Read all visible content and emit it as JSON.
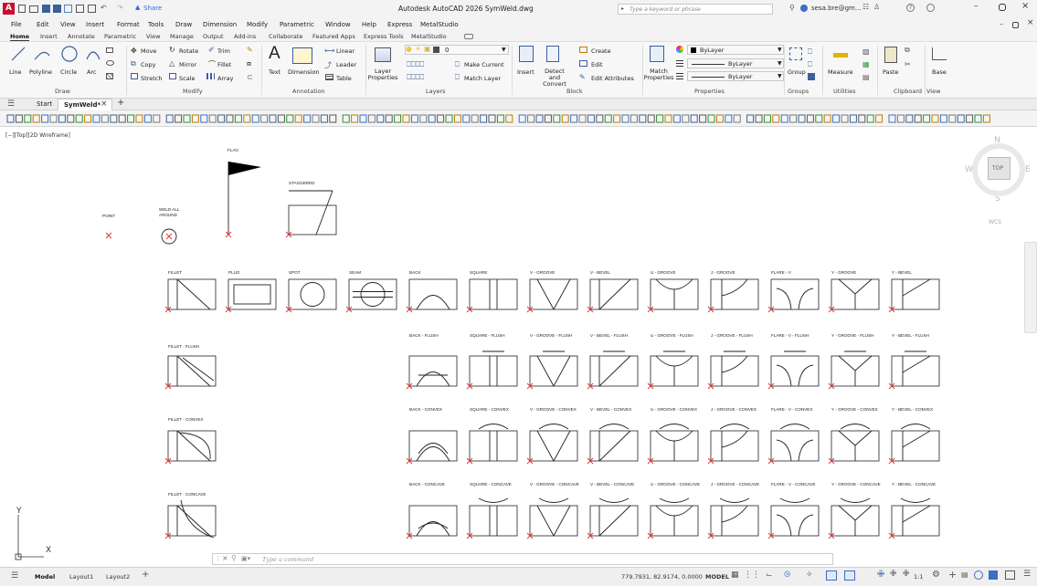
{
  "app": {
    "title": "Autodesk AutoCAD 2026  SymWeld.dwg",
    "logo_letter": "A",
    "share_label": "Share",
    "search_placeholder": "Type a keyword or phrase",
    "user": "sesa.bre@gm...",
    "brand_color": "#c8102e"
  },
  "menu": [
    "File",
    "Edit",
    "View",
    "Insert",
    "Format",
    "Tools",
    "Draw",
    "Dimension",
    "Modify",
    "Parametric",
    "Window",
    "Help",
    "Express",
    "MetalStudio"
  ],
  "ribbon_tabs": [
    "Home",
    "Insert",
    "Annotate",
    "Parametric",
    "View",
    "Manage",
    "Output",
    "Add-ins",
    "Collaborate",
    "Featured Apps",
    "Express Tools",
    "MetalStudio"
  ],
  "ribbon": {
    "draw": {
      "line": "Line",
      "polyline": "Polyline",
      "circle": "Circle",
      "arc": "Arc",
      "panel": "Draw"
    },
    "modify": {
      "move": "Move",
      "rotate": "Rotate",
      "trim": "Trim",
      "copy": "Copy",
      "mirror": "Mirror",
      "fillet": "Fillet",
      "stretch": "Stretch",
      "scale": "Scale",
      "array": "Array",
      "panel": "Modify"
    },
    "annotation": {
      "text": "Text",
      "dimension": "Dimension",
      "linear": "Linear",
      "leader": "Leader",
      "table": "Table",
      "panel": "Annotation"
    },
    "layers": {
      "layer_properties": "Layer Properties",
      "make_current": "Make Current",
      "match_layer": "Match Layer",
      "current_layer": "0",
      "panel": "Layers"
    },
    "block": {
      "insert": "Insert",
      "create": "Create",
      "edit": "Edit",
      "edit_attributes": "Edit Attributes",
      "detect_convert": "Detect and Convert",
      "panel": "Block"
    },
    "properties": {
      "match": "Match Properties",
      "bylayer1": "ByLayer",
      "bylayer2": "ByLayer",
      "bylayer3": "ByLayer",
      "panel": "Properties"
    },
    "groups": {
      "group": "Group",
      "panel": "Groups"
    },
    "utilities": {
      "measure": "Measure",
      "panel": "Utilities"
    },
    "clipboard": {
      "paste": "Paste",
      "panel": "Clipboard"
    },
    "view": {
      "base": "Base",
      "panel": "View"
    }
  },
  "doc_tabs": {
    "start": "Start",
    "active": "SymWeld*"
  },
  "viewport_label": "[−][Top][2D Wireframe]",
  "viewcube": {
    "north": "N",
    "south": "S",
    "east": "E",
    "west": "W",
    "top": "TOP",
    "wcs": "WCS"
  },
  "ucs": {
    "x": "X",
    "y": "Y"
  },
  "symbols": {
    "point": "POINT",
    "weld_all_around": "WELD ALL\nAROUND",
    "flag": "FLAG",
    "staggered": "STAGGERED"
  },
  "row1": [
    "FILLET",
    "PLUG",
    "SPOT",
    "SEAM",
    "BACK",
    "SQUARE",
    "V - GROOVE",
    "V - BEVEL",
    "U - GROOVE",
    "J - GROOVE",
    "FLARE - V",
    "Y - GROOVE",
    "Y - BEVEL"
  ],
  "row2": [
    "FILLET - FLUSH",
    "BACK - FLUSH",
    "SQUARE - FLUSH",
    "V - GROOVE - FLUSH",
    "V - BEVEL - FLUSH",
    "U - GROOVE - FLUSH",
    "J - GROOVE - FLUSH",
    "FLARE - V - FLUSH",
    "Y - GROOVE - FLUSH",
    "Y - BEVEL - FLUSH"
  ],
  "row3": [
    "FILLET - CONVEX",
    "BACK - CONVEX",
    "SQUARE - CONVEX",
    "V - GROOVE - CONVEX",
    "V - BEVEL - CONVEX",
    "U - GROOVE - CONVEX",
    "J - GROOVE - CONVEX",
    "FLARE - V - CONVEX",
    "Y - GROOVE - CONVEX",
    "Y - BEVEL - CONVEX"
  ],
  "row4": [
    "FILLET - CONCAVE",
    "BACK - CONCAVE",
    "SQUARE - CONCAVE",
    "V - GROOVE - CONCAVE",
    "V - BEVEL - CONCAVE",
    "U - GROOVE - CONCAVE",
    "J - GROOVE - CONCAVE",
    "FLARE - V - CONCAVE",
    "Y - GROOVE - CONCAVE",
    "Y - BEVEL - CONCAVE"
  ],
  "command": {
    "placeholder": "Type a command"
  },
  "status": {
    "model_tab": "Model",
    "layout1": "Layout1",
    "layout2": "Layout2",
    "coords": "779.7931, 82.9174, 0.0000",
    "model": "MODEL",
    "scale": "1:1"
  }
}
